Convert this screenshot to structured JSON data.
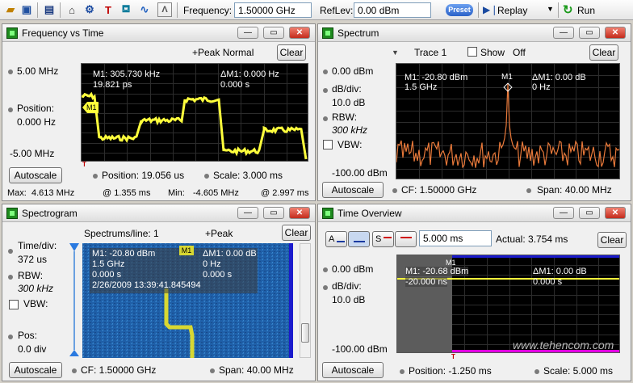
{
  "toolbar": {
    "frequency_label": "Frequency:",
    "frequency_value": "1.50000 GHz",
    "reflev_label": "RefLev:",
    "reflev_value": "0.00 dBm",
    "preset_label": "Preset",
    "replay_label": "Replay",
    "run_label": "Run"
  },
  "fvt": {
    "title": "Frequency vs Time",
    "top_label": "+Peak Normal",
    "clear": "Clear",
    "top_freq": "5.00 MHz",
    "position_label": "Position:",
    "position_value": "0.000 Hz",
    "bottom_freq": "-5.00 MHz",
    "autoscale": "Autoscale",
    "time_position": "Position: 19.056 us",
    "time_scale": "Scale: 3.000 ms",
    "max_label": "Max:",
    "max_value": "4.613 MHz",
    "max_time": "@ 1.355 ms",
    "min_label": "Min:",
    "min_value": "-4.605 MHz",
    "min_time": "@ 2.997 ms",
    "m1_line1": "M1: 305.730 kHz",
    "m1_line2": "19.821 ps",
    "dm1_line1": "ΔM1: 0.000 Hz",
    "dm1_line2": "0.000 s",
    "marker": "M1",
    "trigger_marker": "T"
  },
  "spectrum": {
    "title": "Spectrum",
    "trace": "Trace 1",
    "show": "Show",
    "off": "Off",
    "clear": "Clear",
    "ref": "0.00 dBm",
    "dbdiv_label": "dB/div:",
    "dbdiv_value": "10.0 dB",
    "rbw_label": "RBW:",
    "rbw_value": "300 kHz",
    "vbw_label": "VBW:",
    "bottom": "-100.00 dBm",
    "autoscale": "Autoscale",
    "cf": "CF: 1.50000 GHz",
    "span": "Span: 40.00 MHz",
    "m1_line1": "M1: -20.80 dBm",
    "m1_line2": "1.5 GHz",
    "dm1_line1": "ΔM1: 0.00 dB",
    "dm1_line2": "0 Hz",
    "marker": "M1"
  },
  "spectrogram": {
    "title": "Spectrogram",
    "spectrums": "Spectrums/line: 1",
    "peak": "+Peak",
    "clear": "Clear",
    "timediv_label": "Time/div:",
    "timediv_value": "372 us",
    "rbw_label": "RBW:",
    "rbw_value": "300 kHz",
    "vbw_label": "VBW:",
    "pos_label": "Pos:",
    "pos_value": "0.0 div",
    "autoscale": "Autoscale",
    "cf": "CF: 1.50000 GHz",
    "span": "Span: 40.00 MHz",
    "m1_line1": "M1: -20.80 dBm",
    "m1_line2": "1.5 GHz",
    "m1_line3": "0.000 s",
    "m1_line4": "2/26/2009 13:39:41.845494",
    "dm1_line1": "ΔM1: 0.00 dB",
    "dm1_line2": "0 Hz",
    "dm1_line3": "0.000 s",
    "marker": "M1"
  },
  "timeoverview": {
    "title": "Time Overview",
    "a_btn": "A",
    "s_btn": "S",
    "time_value": "5.000 ms",
    "actual": "Actual: 3.754 ms",
    "clear": "Clear",
    "ref": "0.00 dBm",
    "dbdiv_label": "dB/div:",
    "dbdiv_value": "10.0 dB",
    "bottom": "-100.00 dBm",
    "autoscale": "Autoscale",
    "position": "Position: -1.250 ms",
    "scale": "Scale: 5.000 ms",
    "m1_line1": "M1: -20.68 dBm",
    "m1_line2": "-20.000 ns",
    "dm1_line1": "ΔM1: 0.00 dB",
    "dm1_line2": "0.000 s",
    "marker": "M1",
    "trigger_marker": "T"
  },
  "watermark": "www.tehencom.com",
  "colors": {
    "trace_yellow": "#ffff3c",
    "trace_orange": "#e8793a",
    "spectrogram_bg": "#1f5fa8",
    "marker_blue": "#1a1acc",
    "time_magenta": "#e000e0"
  }
}
